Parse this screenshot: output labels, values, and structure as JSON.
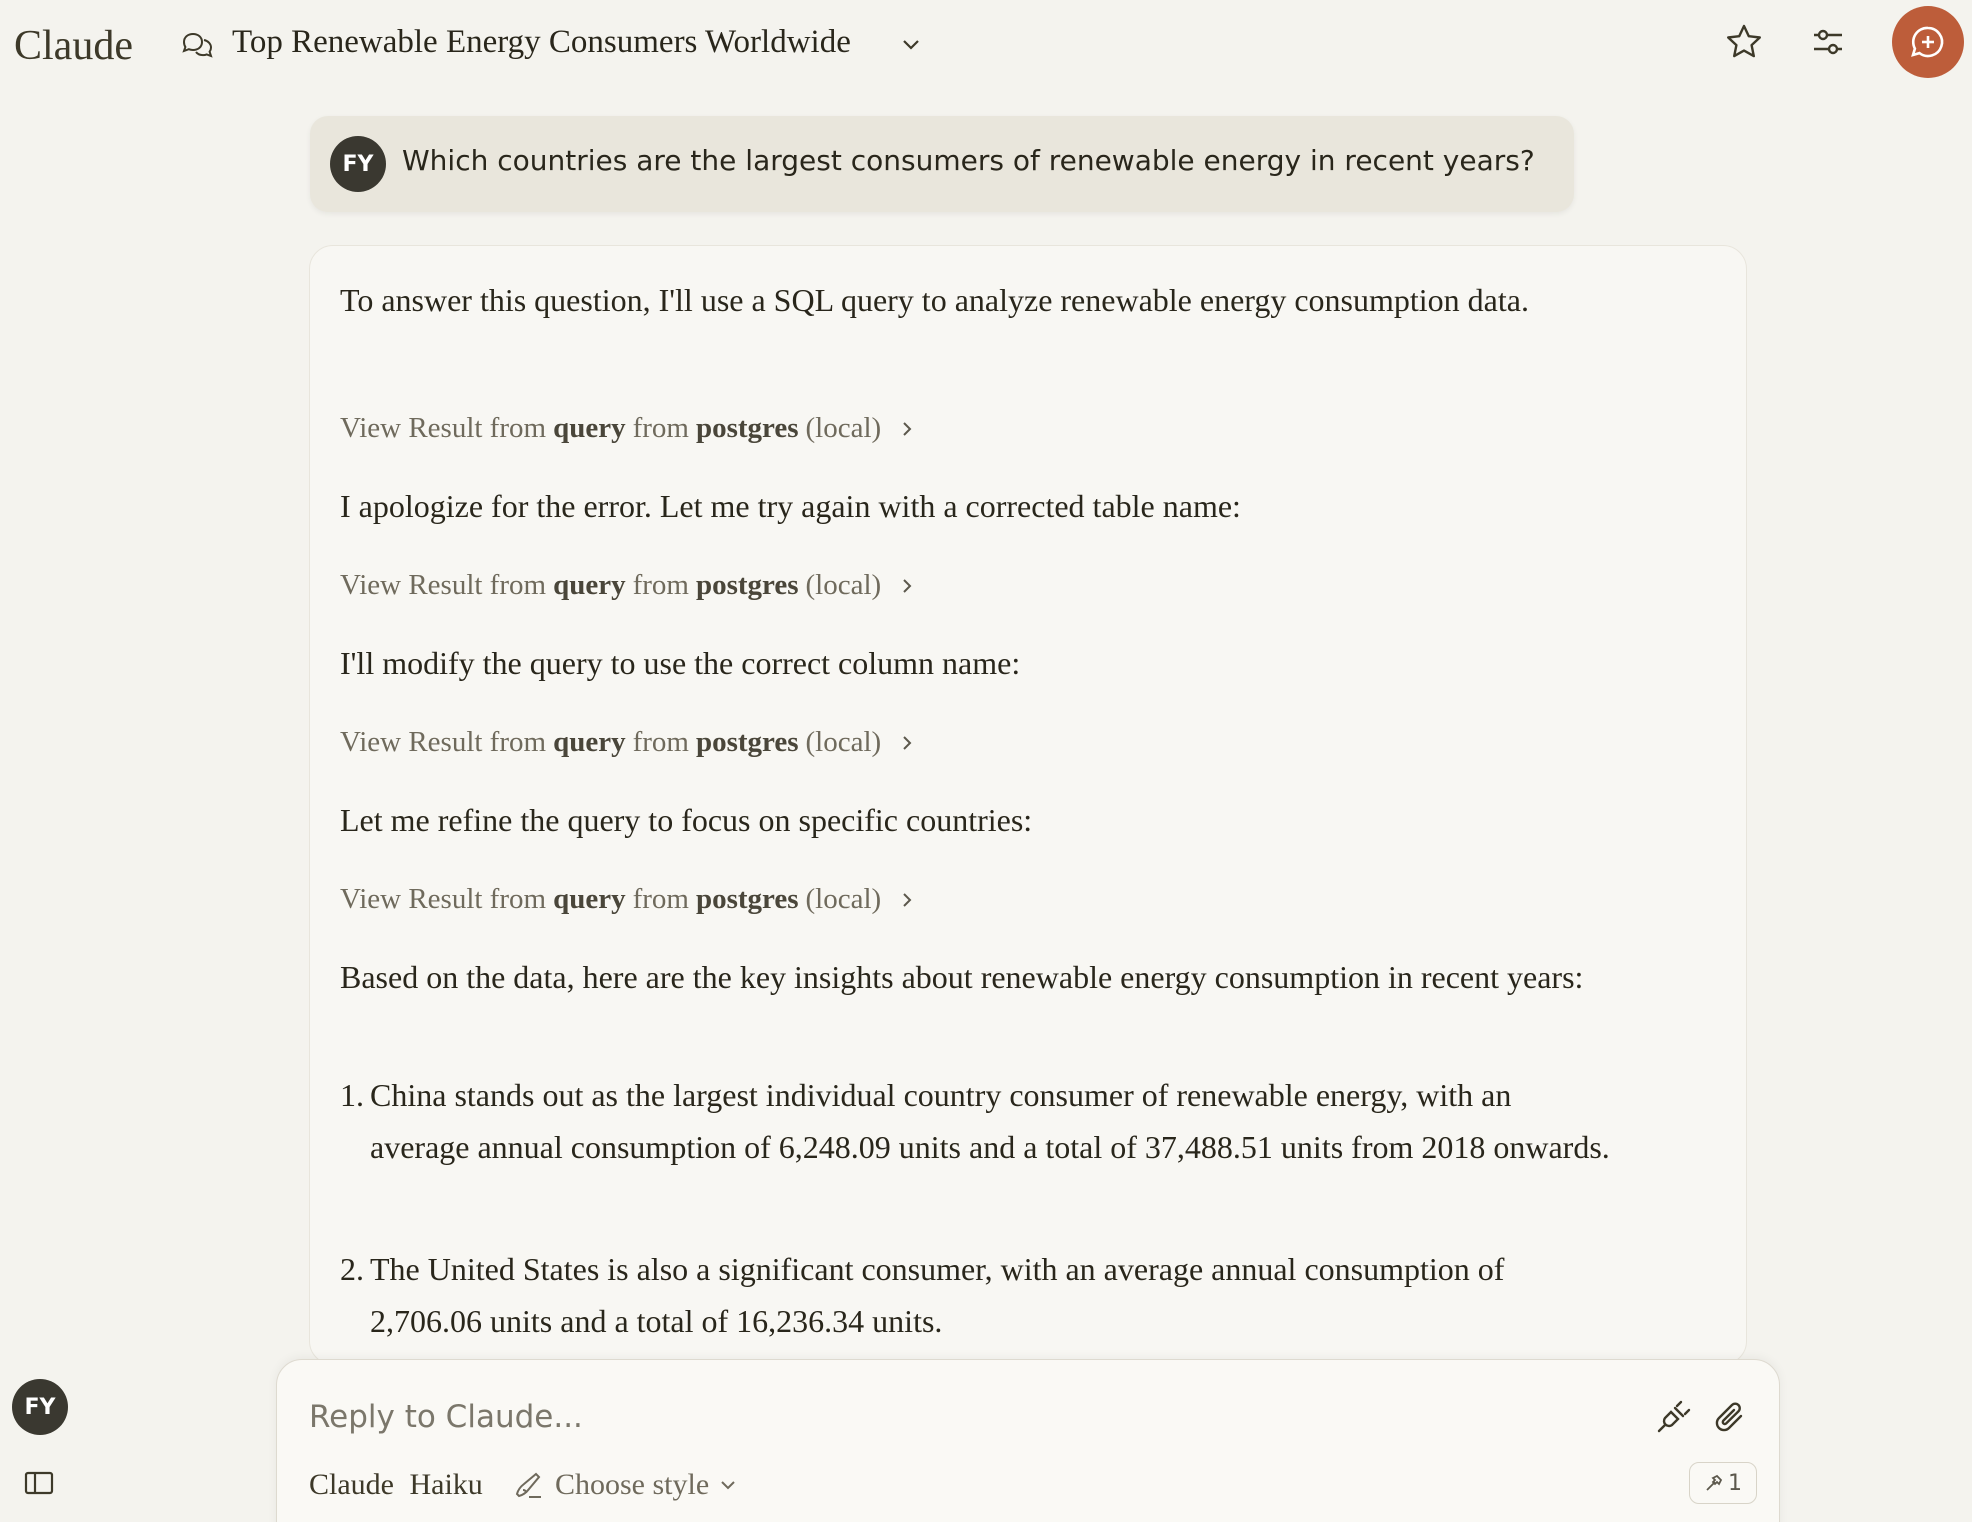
{
  "header": {
    "app_name": "Claude",
    "chat_title": "Top Renewable Energy Consumers Worldwide"
  },
  "user": {
    "initials": "FY",
    "message": "Which countries are the largest consumers of renewable energy in recent years?"
  },
  "assistant": {
    "p1": "To answer this question, I'll use a SQL query to analyze renewable energy consumption data.",
    "tool_results": [
      {
        "prefix": "View Result from",
        "tool": "query",
        "mid": "from",
        "server": "postgres",
        "suffix": "(local)"
      },
      {
        "prefix": "View Result from",
        "tool": "query",
        "mid": "from",
        "server": "postgres",
        "suffix": "(local)"
      },
      {
        "prefix": "View Result from",
        "tool": "query",
        "mid": "from",
        "server": "postgres",
        "suffix": "(local)"
      },
      {
        "prefix": "View Result from",
        "tool": "query",
        "mid": "from",
        "server": "postgres",
        "suffix": "(local)"
      }
    ],
    "p2": "I apologize for the error. Let me try again with a corrected table name:",
    "p3": "I'll modify the query to use the correct column name:",
    "p4": "Let me refine the query to focus on specific countries:",
    "p5": "Based on the data, here are the key insights about renewable energy consumption in recent years:",
    "list": [
      {
        "num": "1.",
        "text": "China stands out as the largest individual country consumer of renewable energy, with an average annual consumption of 6,248.09 units and a total of 37,488.51 units from 2018 onwards."
      },
      {
        "num": "2.",
        "text": "The United States is also a significant consumer, with an average annual consumption of 2,706.06 units and a total of 16,236.34 units."
      }
    ]
  },
  "composer": {
    "placeholder": "Reply to Claude...",
    "model_brand": "Claude",
    "model_variant": "Haiku",
    "style_label": "Choose style",
    "tools_count": "1"
  },
  "colors": {
    "background": "#f4f3ee",
    "accent": "#bd5d3a",
    "user_bubble": "#e9e6dc",
    "avatar": "#3a3830"
  }
}
